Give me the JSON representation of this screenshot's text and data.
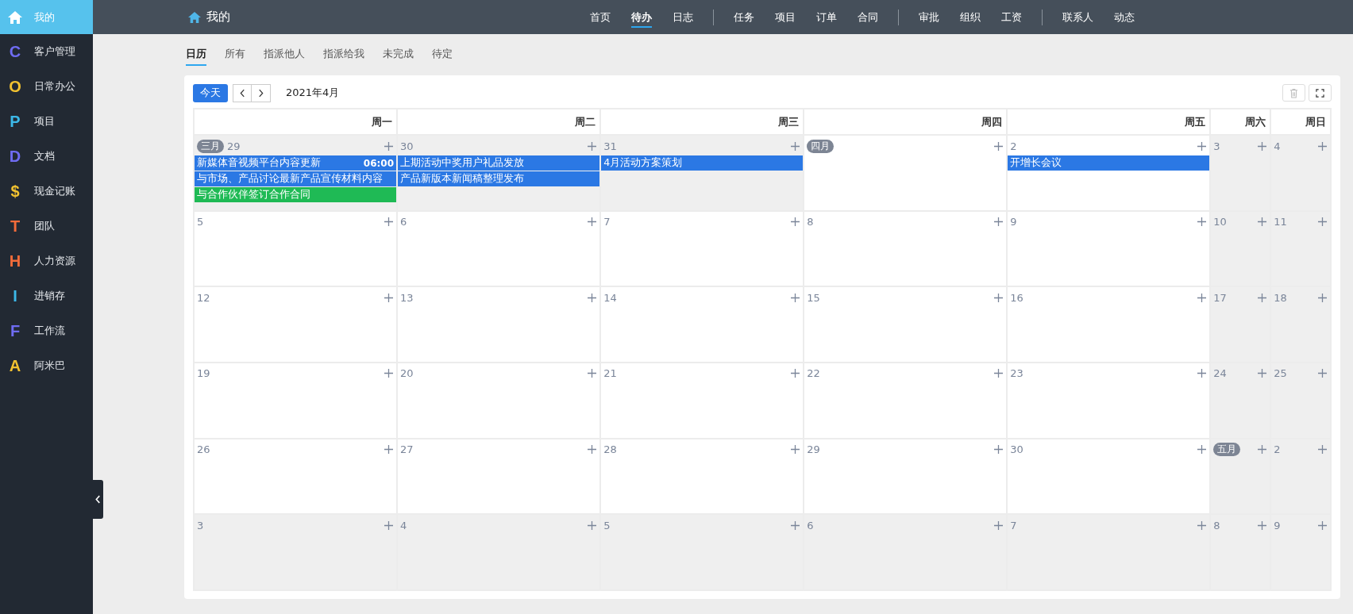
{
  "sidebar": {
    "items": [
      {
        "kind": "home",
        "label": "我的",
        "selected": true
      },
      {
        "kind": "letter",
        "glyph": "C",
        "color": "#6f6cf2",
        "label": "客户管理",
        "selected": false
      },
      {
        "kind": "letter",
        "glyph": "O",
        "color": "#f2c230",
        "label": "日常办公",
        "selected": false
      },
      {
        "kind": "letter",
        "glyph": "P",
        "color": "#3cb8e8",
        "label": "项目",
        "selected": false
      },
      {
        "kind": "letter",
        "glyph": "D",
        "color": "#6f6cf2",
        "label": "文档",
        "selected": false
      },
      {
        "kind": "letter",
        "glyph": "$",
        "color": "#f2c230",
        "label": "现金记账",
        "selected": false
      },
      {
        "kind": "letter",
        "glyph": "T",
        "color": "#f26b3a",
        "label": "团队",
        "selected": false
      },
      {
        "kind": "letter",
        "glyph": "H",
        "color": "#f26b3a",
        "label": "人力资源",
        "selected": false
      },
      {
        "kind": "letter",
        "glyph": "I",
        "color": "#3cb8e8",
        "label": "进销存",
        "selected": false
      },
      {
        "kind": "letter",
        "glyph": "F",
        "color": "#6f6cf2",
        "label": "工作流",
        "selected": false
      },
      {
        "kind": "letter",
        "glyph": "A",
        "color": "#f2c230",
        "label": "阿米巴",
        "selected": false
      }
    ]
  },
  "header": {
    "title": "我的"
  },
  "nav_groups": [
    {
      "items": [
        {
          "label": "首页",
          "selected": false
        },
        {
          "label": "待办",
          "selected": true
        },
        {
          "label": "日志",
          "selected": false
        }
      ]
    },
    {
      "items": [
        {
          "label": "任务",
          "selected": false
        },
        {
          "label": "项目",
          "selected": false
        },
        {
          "label": "订单",
          "selected": false
        },
        {
          "label": "合同",
          "selected": false
        }
      ]
    },
    {
      "items": [
        {
          "label": "审批",
          "selected": false
        },
        {
          "label": "组织",
          "selected": false
        },
        {
          "label": "工资",
          "selected": false
        }
      ]
    },
    {
      "items": [
        {
          "label": "联系人",
          "selected": false
        },
        {
          "label": "动态",
          "selected": false
        }
      ]
    }
  ],
  "tabs": [
    {
      "label": "日历",
      "selected": true
    },
    {
      "label": "所有",
      "selected": false
    },
    {
      "label": "指派他人",
      "selected": false
    },
    {
      "label": "指派给我",
      "selected": false
    },
    {
      "label": "未完成",
      "selected": false
    },
    {
      "label": "待定",
      "selected": false
    }
  ],
  "toolbar": {
    "today": "今天",
    "month": "2021年4月"
  },
  "weekdays": [
    "周一",
    "周二",
    "周三",
    "周四",
    "周五",
    "周六",
    "周日"
  ],
  "weeks": [
    [
      {
        "badge": "三月",
        "date": "29",
        "muted": true,
        "events": [
          {
            "title": "新媒体音视频平台内容更新",
            "time": "06:00",
            "color": "#2b78e4"
          },
          {
            "title": "与市场、产品讨论最新产品宣传材料内容",
            "color": "#2b78e4"
          },
          {
            "title": "与合作伙伴签订合作合同",
            "color": "#1fba55"
          }
        ]
      },
      {
        "date": "30",
        "muted": true,
        "events": [
          {
            "title": "上期活动中奖用户礼品发放",
            "color": "#2b78e4"
          },
          {
            "title": "产品新版本新闻稿整理发布",
            "color": "#2b78e4"
          }
        ]
      },
      {
        "date": "31",
        "muted": true,
        "events": [
          {
            "title": "4月活动方案策划",
            "color": "#2b78e4"
          }
        ]
      },
      {
        "badge": "四月",
        "muted": false
      },
      {
        "date": "2",
        "muted": false,
        "events": [
          {
            "title": "开增长会议",
            "color": "#2b78e4"
          }
        ]
      },
      {
        "date": "3",
        "muted": true
      },
      {
        "date": "4",
        "muted": true
      }
    ],
    [
      {
        "date": "5",
        "muted": false
      },
      {
        "date": "6",
        "muted": false
      },
      {
        "date": "7",
        "muted": false
      },
      {
        "date": "8",
        "muted": false
      },
      {
        "date": "9",
        "muted": false
      },
      {
        "date": "10",
        "muted": true
      },
      {
        "date": "11",
        "muted": true
      }
    ],
    [
      {
        "date": "12",
        "muted": false
      },
      {
        "date": "13",
        "muted": false
      },
      {
        "date": "14",
        "muted": false
      },
      {
        "date": "15",
        "muted": false
      },
      {
        "date": "16",
        "muted": false
      },
      {
        "date": "17",
        "muted": true
      },
      {
        "date": "18",
        "muted": true
      }
    ],
    [
      {
        "date": "19",
        "muted": false
      },
      {
        "date": "20",
        "muted": false
      },
      {
        "date": "21",
        "muted": false
      },
      {
        "date": "22",
        "muted": false
      },
      {
        "date": "23",
        "muted": false
      },
      {
        "date": "24",
        "muted": true
      },
      {
        "date": "25",
        "muted": true
      }
    ],
    [
      {
        "date": "26",
        "muted": false
      },
      {
        "date": "27",
        "muted": false
      },
      {
        "date": "28",
        "muted": false
      },
      {
        "date": "29",
        "muted": false
      },
      {
        "date": "30",
        "muted": false
      },
      {
        "badge": "五月",
        "muted": true
      },
      {
        "date": "2",
        "muted": true
      }
    ],
    [
      {
        "date": "3",
        "muted": true
      },
      {
        "date": "4",
        "muted": true
      },
      {
        "date": "5",
        "muted": true
      },
      {
        "date": "6",
        "muted": true
      },
      {
        "date": "7",
        "muted": true
      },
      {
        "date": "8",
        "muted": true
      },
      {
        "date": "9",
        "muted": true
      }
    ]
  ]
}
